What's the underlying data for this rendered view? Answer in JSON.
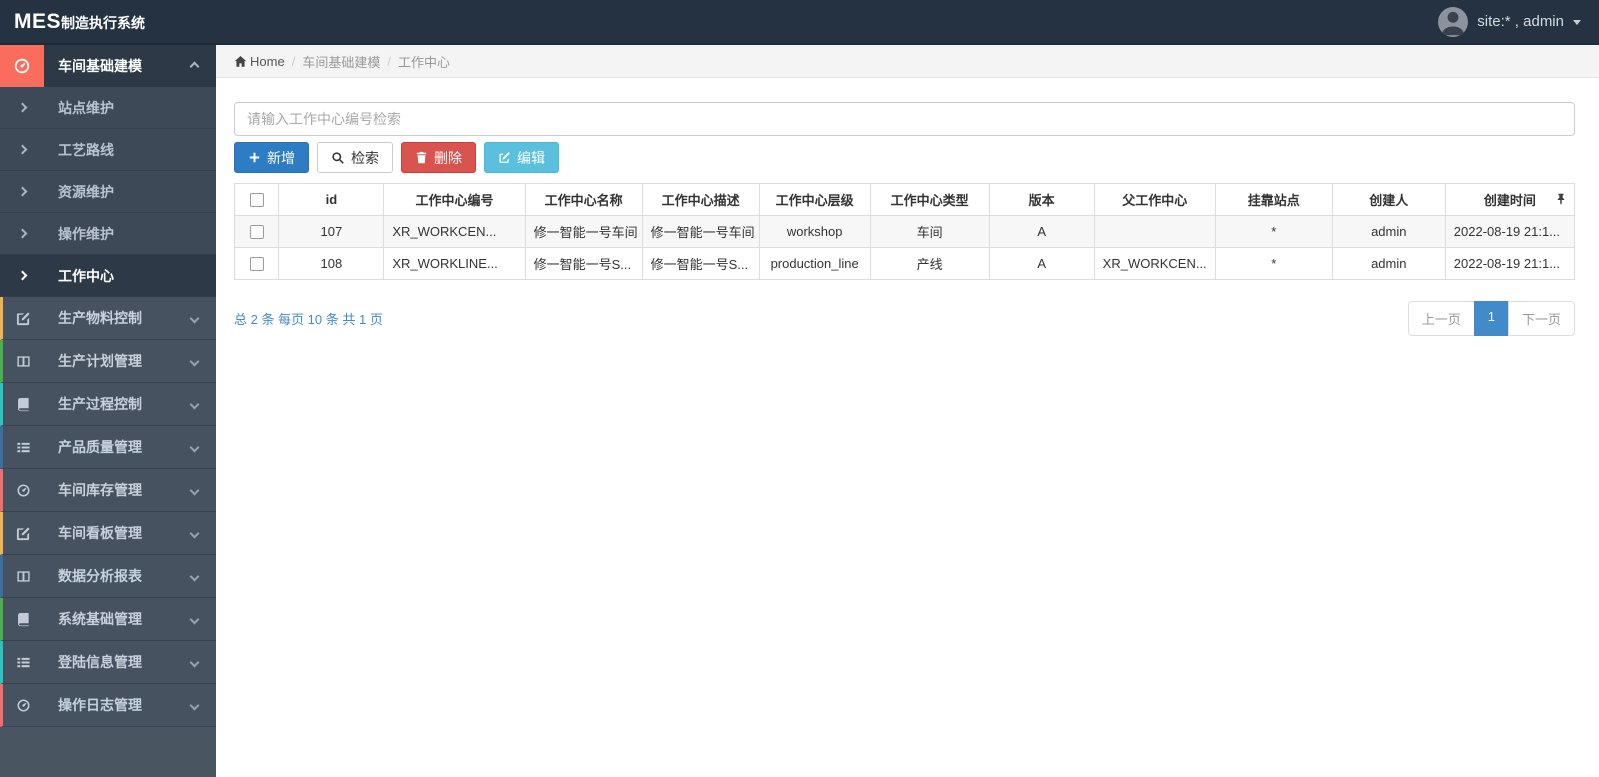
{
  "colors": {
    "topbar_bg": "#253241",
    "sidebar_bg": "#46525f",
    "accent_red": "#fa6d5c",
    "primary_button_blue": "#2d7dc5",
    "danger_button_red": "#d9534f",
    "info_button_blue": "#5bc0de",
    "pagination_blue": "#428bca"
  },
  "topbar": {
    "logo_mes": "MES",
    "logo_suffix": "制造执行系统",
    "user_label": "site:* , admin"
  },
  "sidebar": {
    "group": {
      "label": "车间基础建模",
      "icon": "gauge-icon"
    },
    "submenu": [
      {
        "label": "站点维护"
      },
      {
        "label": "工艺路线"
      },
      {
        "label": "资源维护"
      },
      {
        "label": "操作维护"
      },
      {
        "label": "工作中心",
        "active": true
      }
    ],
    "items": [
      {
        "label": "生产物料控制",
        "icon": "pencil-square-icon",
        "stripe_color": "#efb353"
      },
      {
        "label": "生产计划管理",
        "icon": "columns-icon",
        "stripe_color": "#4cae4c"
      },
      {
        "label": "生产过程控制",
        "icon": "book-icon",
        "stripe_color": "#2dc3c3"
      },
      {
        "label": "产品质量管理",
        "icon": "list-icon",
        "stripe_color": "#3c6e9f"
      },
      {
        "label": "车间库存管理",
        "icon": "gauge-icon",
        "stripe_color": "#ef6f6c"
      },
      {
        "label": "车间看板管理",
        "icon": "pencil-square-icon",
        "stripe_color": "#efb353"
      },
      {
        "label": "数据分析报表",
        "icon": "columns-icon",
        "stripe_color": "#3c6e9f"
      },
      {
        "label": "系统基础管理",
        "icon": "book-icon",
        "stripe_color": "#4cae4c"
      },
      {
        "label": "登陆信息管理",
        "icon": "list-icon",
        "stripe_color": "#2dc3c3"
      },
      {
        "label": "操作日志管理",
        "icon": "gauge-icon",
        "stripe_color": "#ef6f6c"
      }
    ]
  },
  "breadcrumb": {
    "home": "Home",
    "sep": "/",
    "crumb1": "车间基础建模",
    "crumb2": "工作中心"
  },
  "toolbar": {
    "search_placeholder": "请输入工作中心编号检索",
    "add_label": "新增",
    "search_label": "检索",
    "delete_label": "删除",
    "edit_label": "编辑"
  },
  "table": {
    "columns": [
      "id",
      "工作中心编号",
      "工作中心名称",
      "工作中心描述",
      "工作中心层级",
      "工作中心类型",
      "版本",
      "父工作中心",
      "挂靠站点",
      "创建人",
      "创建时间"
    ],
    "rows": [
      {
        "id": "107",
        "code": "XR_WORKCEN...",
        "name": "修一智能一号车间",
        "desc": "修一智能一号车间",
        "level": "workshop",
        "type": "车间",
        "version": "A",
        "parent": "",
        "station": "*",
        "creator": "admin",
        "created": "2022-08-19 21:1..."
      },
      {
        "id": "108",
        "code": "XR_WORKLINE...",
        "name": "修一智能一号S...",
        "desc": "修一智能一号S...",
        "level": "production_line",
        "type": "产线",
        "version": "A",
        "parent": "XR_WORKCEN...",
        "station": "*",
        "creator": "admin",
        "created": "2022-08-19 21:1..."
      }
    ]
  },
  "pagination": {
    "summary": "总 2 条  每页 10 条  共 1 页",
    "prev": "上一页",
    "current": "1",
    "next": "下一页"
  }
}
